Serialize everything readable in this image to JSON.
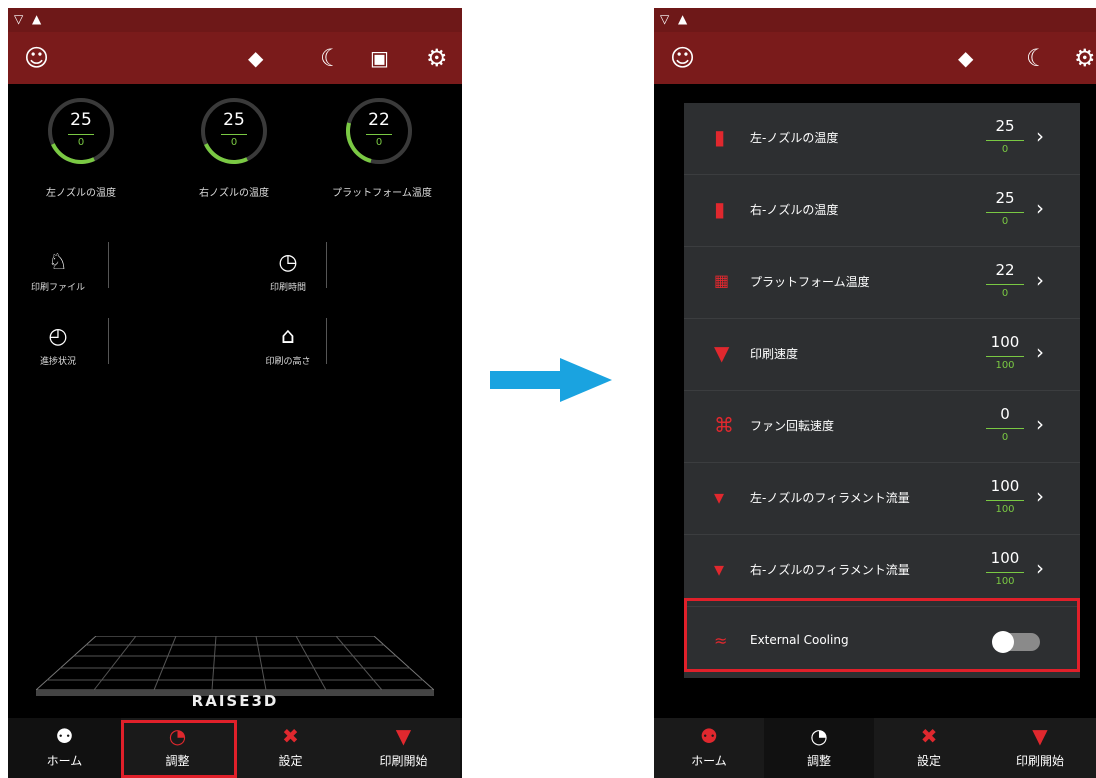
{
  "left": {
    "dials": [
      {
        "current": "25",
        "target": "0",
        "label": "左ノズルの温度"
      },
      {
        "current": "25",
        "target": "0",
        "label": "右ノズルの温度"
      },
      {
        "current": "22",
        "target": "0",
        "label": "プラットフォーム温度"
      }
    ],
    "info": [
      {
        "icon": "pin-icon",
        "label": "印刷ファイル"
      },
      {
        "icon": "clock-icon",
        "label": "印刷時間"
      },
      {
        "icon": "progress-icon",
        "label": "進捗状況"
      },
      {
        "icon": "height-icon",
        "label": "印刷の高さ"
      }
    ],
    "logo": "RAISE3D",
    "nav": [
      {
        "icon": "users-icon",
        "label": "ホーム"
      },
      {
        "icon": "pie-chart-icon",
        "label": "調整"
      },
      {
        "icon": "tools-icon",
        "label": "設定"
      },
      {
        "icon": "print-icon",
        "label": "印刷開始"
      }
    ],
    "highlighted_nav": "調整"
  },
  "right": {
    "rows": [
      {
        "icon": "nozzle-icon",
        "label": "左-ノズルの温度",
        "current": "25",
        "target": "0"
      },
      {
        "icon": "nozzle-icon",
        "label": "右-ノズルの温度",
        "current": "25",
        "target": "0"
      },
      {
        "icon": "platform-icon",
        "label": "プラットフォーム温度",
        "current": "22",
        "target": "0"
      },
      {
        "icon": "speed-icon",
        "label": "印刷速度",
        "current": "100",
        "target": "100"
      },
      {
        "icon": "fan-icon",
        "label": "ファン回転速度",
        "current": "0",
        "target": "0"
      },
      {
        "icon": "filament-icon",
        "label": "左-ノズルのフィラメント流量",
        "current": "100",
        "target": "100"
      },
      {
        "icon": "filament-icon",
        "label": "右-ノズルのフィラメント流量",
        "current": "100",
        "target": "100"
      }
    ],
    "external_cooling": {
      "label": "External Cooling",
      "enabled": false
    },
    "nav": [
      {
        "icon": "users-icon",
        "label": "ホーム"
      },
      {
        "icon": "pie-chart-icon",
        "label": "調整"
      },
      {
        "icon": "tools-icon",
        "label": "設定"
      },
      {
        "icon": "print-icon",
        "label": "印刷開始"
      }
    ]
  },
  "colors": {
    "topbar": "#7a1b1b",
    "accent_green": "#7ac943",
    "accent_red": "#e0282e",
    "highlight": "#e0202a",
    "arrow": "#1aa3e0"
  }
}
